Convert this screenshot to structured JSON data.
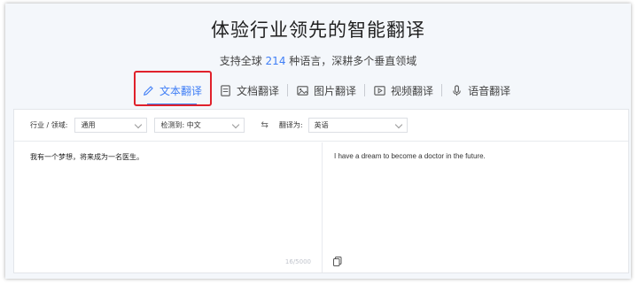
{
  "header": {
    "title": "体验行业领先的智能翻译",
    "subtitle_prefix": "支持全球",
    "subtitle_number": "214",
    "subtitle_suffix": "种语言，深耕多个垂直领域"
  },
  "tabs": [
    {
      "label": "文本翻译",
      "icon": "pencil-icon",
      "active": true
    },
    {
      "label": "文档翻译",
      "icon": "document-icon",
      "active": false
    },
    {
      "label": "图片翻译",
      "icon": "image-icon",
      "active": false
    },
    {
      "label": "视频翻译",
      "icon": "video-icon",
      "active": false
    },
    {
      "label": "语音翻译",
      "icon": "microphone-icon",
      "active": false
    }
  ],
  "toolbar": {
    "industry_label": "行业 / 领域:",
    "industry_value": "通用",
    "detect_value": "检测到: 中文",
    "swap_symbol": "⇆",
    "target_label": "翻译为:",
    "target_value": "英语"
  },
  "source": {
    "text": "我有一个梦想，将来成为一名医生。",
    "char_count": "16/5000"
  },
  "target": {
    "text": "I have a dream to become a doctor in the future."
  },
  "colors": {
    "accent": "#3f7ef6",
    "highlight_box": "#e0212b",
    "background": "#f4f7fb"
  }
}
